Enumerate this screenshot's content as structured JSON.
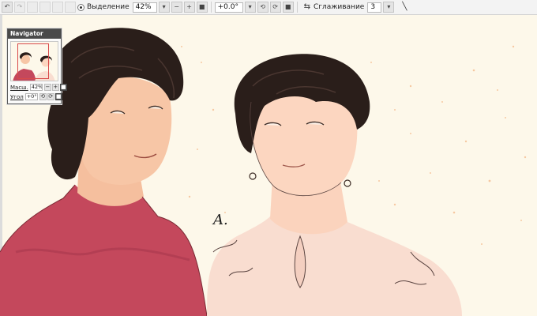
{
  "toolbar": {
    "undo_icon": "undo-icon",
    "selection_label": "Выделение",
    "zoom_value": "42%",
    "zoom_dropdown_icon": "chevron-down-icon",
    "zoom_out_icon": "minus-icon",
    "zoom_in_icon": "plus-icon",
    "zoom_reset_icon": "square-icon",
    "rotation_value": "+0.0°",
    "rotation_dropdown_icon": "chevron-down-icon",
    "rotate_left_icon": "rotate-left-icon",
    "rotate_right_icon": "rotate-right-icon",
    "rotate_reset_icon": "square-icon",
    "flip_icon": "flip-horizontal-icon",
    "smoothing_label": "Сглаживание",
    "smoothing_value": "3",
    "smoothing_dropdown_icon": "chevron-down-icon",
    "line_tool_icon": "line-icon"
  },
  "navigator": {
    "title": "Navigator",
    "scale_label": "Масш.",
    "scale_value": "42%",
    "angle_label": "Угол",
    "angle_value": "+0°"
  },
  "canvas": {
    "signature_text": "A."
  },
  "colors": {
    "canvas_background": "#fdf8ea",
    "toolbar_background": "#f3f3f3",
    "left_shirt": "#c4485c",
    "right_blouse": "#f9ddd0",
    "skin": "#f7c6a6",
    "hair": "#2a1e1a"
  }
}
